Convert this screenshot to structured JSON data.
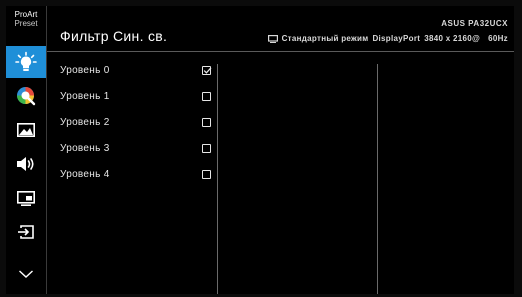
{
  "sidebar": {
    "logo_line1": "ProArt",
    "logo_line2": "Preset",
    "items": [
      {
        "icon": "bluelight-icon",
        "active": true
      },
      {
        "icon": "color-icon",
        "active": false
      },
      {
        "icon": "image-icon",
        "active": false
      },
      {
        "icon": "sound-icon",
        "active": false
      },
      {
        "icon": "pip-icon",
        "active": false
      },
      {
        "icon": "input-select-icon",
        "active": false
      },
      {
        "icon": "chevron-down-icon",
        "active": false
      }
    ]
  },
  "header": {
    "title": "Фильтр Син. св.",
    "model": "ASUS PA32UCX",
    "status_mode": "Стандартный режим",
    "status_input": "DisplayPort",
    "status_resolution": "3840 x 2160@",
    "status_refresh": "60Hz"
  },
  "menu": {
    "items": [
      {
        "label": "Уровень 0",
        "checked": true
      },
      {
        "label": "Уровень 1",
        "checked": false
      },
      {
        "label": "Уровень 2",
        "checked": false
      },
      {
        "label": "Уровень 3",
        "checked": false
      },
      {
        "label": "Уровень 4",
        "checked": false
      }
    ]
  },
  "colors": {
    "accent": "#1f8fd8",
    "background": "#000000",
    "text": "#e6e6e6"
  }
}
